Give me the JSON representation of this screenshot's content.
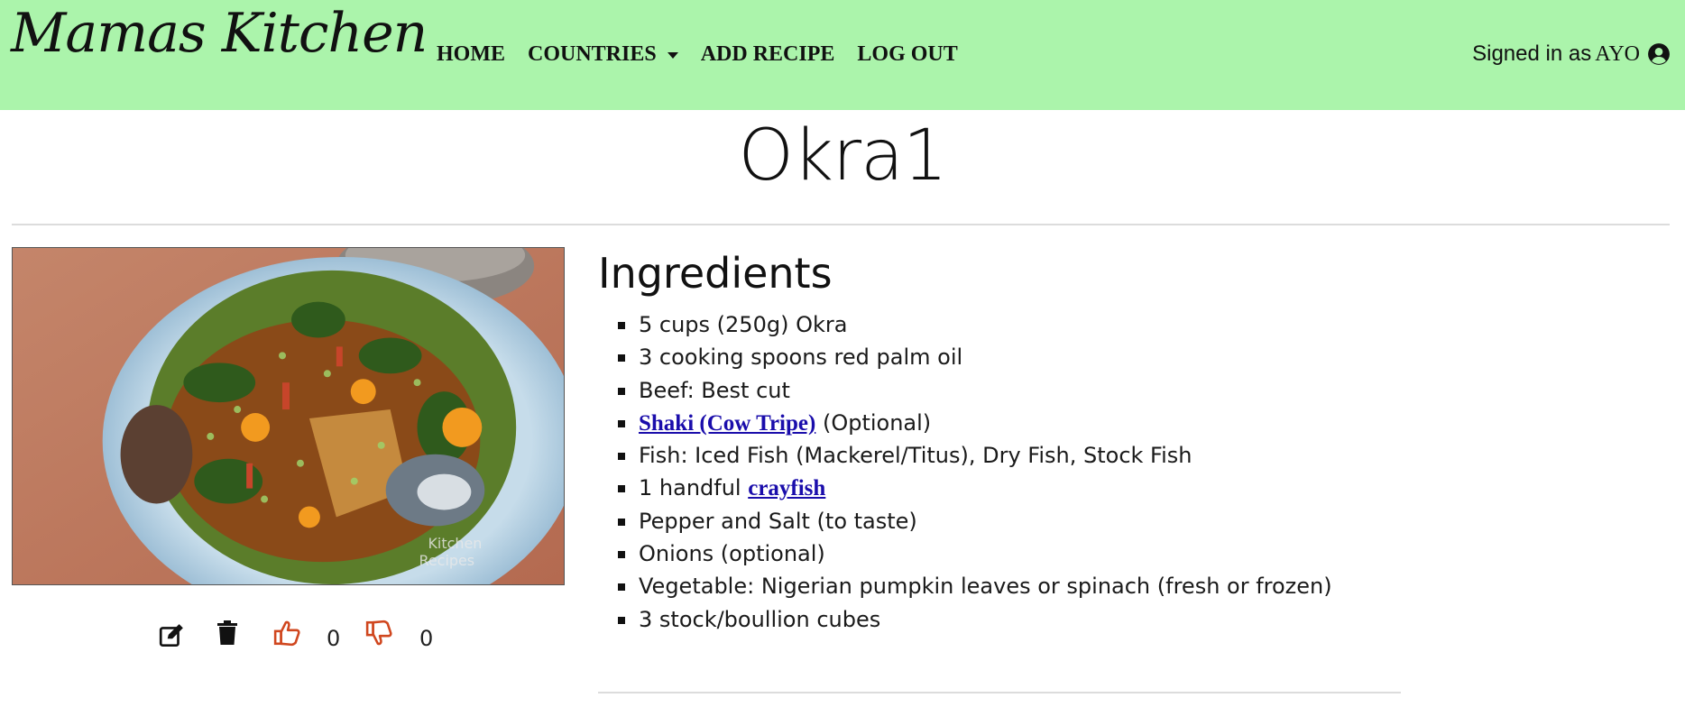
{
  "brand": "Mamas Kitchen",
  "nav": {
    "home": "HOME",
    "countries": "COUNTRIES",
    "add_recipe": "ADD RECIPE",
    "log_out": "LOG OUT"
  },
  "user": {
    "signed_in_label": "Signed in as",
    "username": "AYO",
    "icon": "user-circle-icon"
  },
  "recipe": {
    "title": "Okra1",
    "image_watermark": "Kitchen Recipes",
    "likes": "0",
    "dislikes": "0"
  },
  "ingredients": {
    "heading": "Ingredients",
    "items": [
      {
        "text": "5 cups (250g) Okra"
      },
      {
        "text": "3 cooking spoons red palm oil"
      },
      {
        "text": "Beef: Best cut"
      },
      {
        "link": "Shaki (Cow Tripe)",
        "after": " (Optional)"
      },
      {
        "text": "Fish: Iced Fish (Mackerel/Titus), Dry Fish, Stock Fish"
      },
      {
        "before": "1 handful ",
        "link": "crayfish"
      },
      {
        "text": "Pepper and Salt (to taste)"
      },
      {
        "text": "Onions (optional)"
      },
      {
        "text": "Vegetable: Nigerian pumpkin leaves or spinach (fresh or frozen)"
      },
      {
        "text": "3 stock/boullion cubes"
      }
    ]
  },
  "colors": {
    "navbar_bg": "#abf4ab",
    "thumb_color": "#d0471f",
    "link_color": "#1a0dab"
  },
  "icons": {
    "edit": "edit-icon",
    "delete": "trash-icon",
    "like": "thumbs-up-icon",
    "dislike": "thumbs-down-icon"
  }
}
